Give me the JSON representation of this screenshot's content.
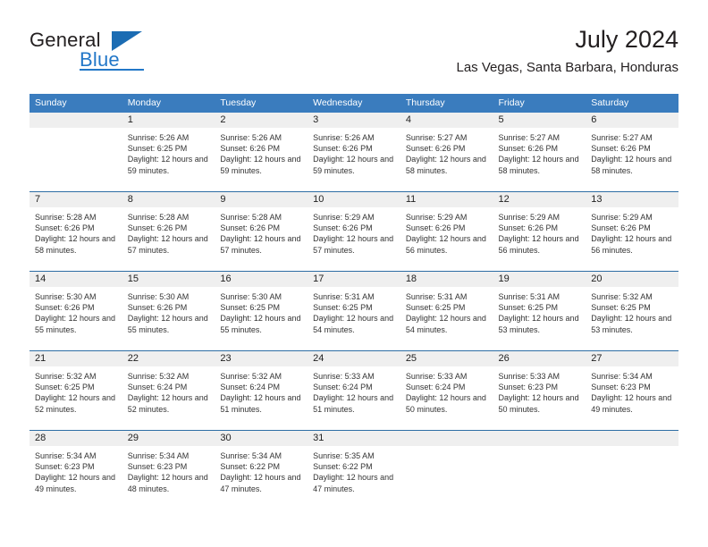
{
  "brand": {
    "name_part1": "General",
    "name_part2": "Blue",
    "triangle_color": "#1b6cb3",
    "blue_color": "#2277c8"
  },
  "header": {
    "title": "July 2024",
    "subtitle": "Las Vegas, Santa Barbara, Honduras"
  },
  "theme": {
    "header_bg": "#3a7cbe",
    "row_divider": "#2d6da4",
    "datenum_bg": "#efefef",
    "text": "#222222"
  },
  "weekdays": [
    "Sunday",
    "Monday",
    "Tuesday",
    "Wednesday",
    "Thursday",
    "Friday",
    "Saturday"
  ],
  "weeks": [
    [
      {
        "day": "",
        "sunrise": "",
        "sunset": "",
        "daylight": ""
      },
      {
        "day": "1",
        "sunrise": "Sunrise: 5:26 AM",
        "sunset": "Sunset: 6:25 PM",
        "daylight": "Daylight: 12 hours and 59 minutes."
      },
      {
        "day": "2",
        "sunrise": "Sunrise: 5:26 AM",
        "sunset": "Sunset: 6:26 PM",
        "daylight": "Daylight: 12 hours and 59 minutes."
      },
      {
        "day": "3",
        "sunrise": "Sunrise: 5:26 AM",
        "sunset": "Sunset: 6:26 PM",
        "daylight": "Daylight: 12 hours and 59 minutes."
      },
      {
        "day": "4",
        "sunrise": "Sunrise: 5:27 AM",
        "sunset": "Sunset: 6:26 PM",
        "daylight": "Daylight: 12 hours and 58 minutes."
      },
      {
        "day": "5",
        "sunrise": "Sunrise: 5:27 AM",
        "sunset": "Sunset: 6:26 PM",
        "daylight": "Daylight: 12 hours and 58 minutes."
      },
      {
        "day": "6",
        "sunrise": "Sunrise: 5:27 AM",
        "sunset": "Sunset: 6:26 PM",
        "daylight": "Daylight: 12 hours and 58 minutes."
      }
    ],
    [
      {
        "day": "7",
        "sunrise": "Sunrise: 5:28 AM",
        "sunset": "Sunset: 6:26 PM",
        "daylight": "Daylight: 12 hours and 58 minutes."
      },
      {
        "day": "8",
        "sunrise": "Sunrise: 5:28 AM",
        "sunset": "Sunset: 6:26 PM",
        "daylight": "Daylight: 12 hours and 57 minutes."
      },
      {
        "day": "9",
        "sunrise": "Sunrise: 5:28 AM",
        "sunset": "Sunset: 6:26 PM",
        "daylight": "Daylight: 12 hours and 57 minutes."
      },
      {
        "day": "10",
        "sunrise": "Sunrise: 5:29 AM",
        "sunset": "Sunset: 6:26 PM",
        "daylight": "Daylight: 12 hours and 57 minutes."
      },
      {
        "day": "11",
        "sunrise": "Sunrise: 5:29 AM",
        "sunset": "Sunset: 6:26 PM",
        "daylight": "Daylight: 12 hours and 56 minutes."
      },
      {
        "day": "12",
        "sunrise": "Sunrise: 5:29 AM",
        "sunset": "Sunset: 6:26 PM",
        "daylight": "Daylight: 12 hours and 56 minutes."
      },
      {
        "day": "13",
        "sunrise": "Sunrise: 5:29 AM",
        "sunset": "Sunset: 6:26 PM",
        "daylight": "Daylight: 12 hours and 56 minutes."
      }
    ],
    [
      {
        "day": "14",
        "sunrise": "Sunrise: 5:30 AM",
        "sunset": "Sunset: 6:26 PM",
        "daylight": "Daylight: 12 hours and 55 minutes."
      },
      {
        "day": "15",
        "sunrise": "Sunrise: 5:30 AM",
        "sunset": "Sunset: 6:26 PM",
        "daylight": "Daylight: 12 hours and 55 minutes."
      },
      {
        "day": "16",
        "sunrise": "Sunrise: 5:30 AM",
        "sunset": "Sunset: 6:25 PM",
        "daylight": "Daylight: 12 hours and 55 minutes."
      },
      {
        "day": "17",
        "sunrise": "Sunrise: 5:31 AM",
        "sunset": "Sunset: 6:25 PM",
        "daylight": "Daylight: 12 hours and 54 minutes."
      },
      {
        "day": "18",
        "sunrise": "Sunrise: 5:31 AM",
        "sunset": "Sunset: 6:25 PM",
        "daylight": "Daylight: 12 hours and 54 minutes."
      },
      {
        "day": "19",
        "sunrise": "Sunrise: 5:31 AM",
        "sunset": "Sunset: 6:25 PM",
        "daylight": "Daylight: 12 hours and 53 minutes."
      },
      {
        "day": "20",
        "sunrise": "Sunrise: 5:32 AM",
        "sunset": "Sunset: 6:25 PM",
        "daylight": "Daylight: 12 hours and 53 minutes."
      }
    ],
    [
      {
        "day": "21",
        "sunrise": "Sunrise: 5:32 AM",
        "sunset": "Sunset: 6:25 PM",
        "daylight": "Daylight: 12 hours and 52 minutes."
      },
      {
        "day": "22",
        "sunrise": "Sunrise: 5:32 AM",
        "sunset": "Sunset: 6:24 PM",
        "daylight": "Daylight: 12 hours and 52 minutes."
      },
      {
        "day": "23",
        "sunrise": "Sunrise: 5:32 AM",
        "sunset": "Sunset: 6:24 PM",
        "daylight": "Daylight: 12 hours and 51 minutes."
      },
      {
        "day": "24",
        "sunrise": "Sunrise: 5:33 AM",
        "sunset": "Sunset: 6:24 PM",
        "daylight": "Daylight: 12 hours and 51 minutes."
      },
      {
        "day": "25",
        "sunrise": "Sunrise: 5:33 AM",
        "sunset": "Sunset: 6:24 PM",
        "daylight": "Daylight: 12 hours and 50 minutes."
      },
      {
        "day": "26",
        "sunrise": "Sunrise: 5:33 AM",
        "sunset": "Sunset: 6:23 PM",
        "daylight": "Daylight: 12 hours and 50 minutes."
      },
      {
        "day": "27",
        "sunrise": "Sunrise: 5:34 AM",
        "sunset": "Sunset: 6:23 PM",
        "daylight": "Daylight: 12 hours and 49 minutes."
      }
    ],
    [
      {
        "day": "28",
        "sunrise": "Sunrise: 5:34 AM",
        "sunset": "Sunset: 6:23 PM",
        "daylight": "Daylight: 12 hours and 49 minutes."
      },
      {
        "day": "29",
        "sunrise": "Sunrise: 5:34 AM",
        "sunset": "Sunset: 6:23 PM",
        "daylight": "Daylight: 12 hours and 48 minutes."
      },
      {
        "day": "30",
        "sunrise": "Sunrise: 5:34 AM",
        "sunset": "Sunset: 6:22 PM",
        "daylight": "Daylight: 12 hours and 47 minutes."
      },
      {
        "day": "31",
        "sunrise": "Sunrise: 5:35 AM",
        "sunset": "Sunset: 6:22 PM",
        "daylight": "Daylight: 12 hours and 47 minutes."
      },
      {
        "day": "",
        "sunrise": "",
        "sunset": "",
        "daylight": ""
      },
      {
        "day": "",
        "sunrise": "",
        "sunset": "",
        "daylight": ""
      },
      {
        "day": "",
        "sunrise": "",
        "sunset": "",
        "daylight": ""
      }
    ]
  ]
}
